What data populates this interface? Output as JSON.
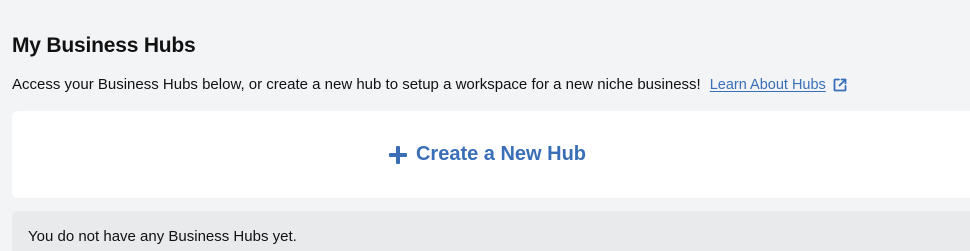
{
  "page": {
    "title": "My Business Hubs",
    "description": "Access your Business Hubs below, or create a new hub to setup a workspace for a new niche business!",
    "learn_link": {
      "label": "Learn About Hubs",
      "icon": "external-link-icon"
    }
  },
  "create_hub": {
    "label": "Create a New Hub",
    "icon": "plus-icon"
  },
  "empty_state": {
    "message": "You do not have any Business Hubs yet."
  },
  "colors": {
    "background": "#f3f4f6",
    "card": "#ffffff",
    "empty_card": "#e9eaec",
    "accent": "#3a6fb8",
    "text": "#111111"
  }
}
